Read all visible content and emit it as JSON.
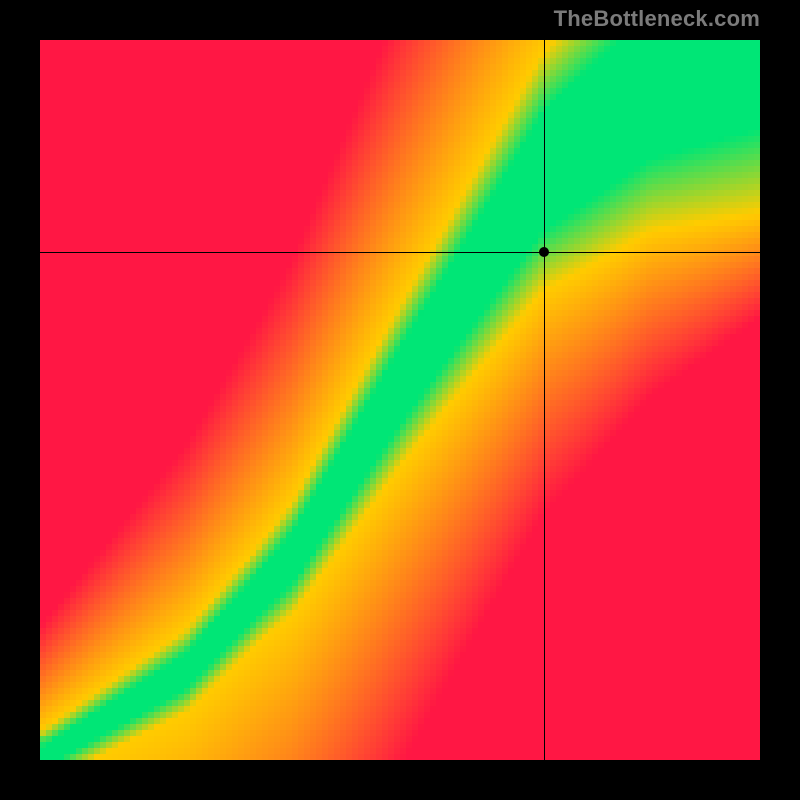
{
  "watermark": "TheBottleneck.com",
  "chart_data": {
    "type": "heatmap",
    "title": "",
    "xlabel": "",
    "ylabel": "",
    "xlim": [
      0,
      100
    ],
    "ylim": [
      0,
      100
    ],
    "grid_resolution": 120,
    "colors": {
      "worst": "#ff1744",
      "mid": "#ffcc00",
      "best": "#00e676"
    },
    "marker": {
      "x": 70,
      "y": 70.5
    },
    "crosshair": {
      "x": 70,
      "y": 70.5
    },
    "ridge_points": [
      {
        "x": 0,
        "y": 0
      },
      {
        "x": 20,
        "y": 12
      },
      {
        "x": 35,
        "y": 28
      },
      {
        "x": 50,
        "y": 52
      },
      {
        "x": 60,
        "y": 67
      },
      {
        "x": 70,
        "y": 82
      },
      {
        "x": 85,
        "y": 94
      },
      {
        "x": 100,
        "y": 100
      }
    ],
    "ridge_width": [
      {
        "x": 0,
        "w": 1.5
      },
      {
        "x": 30,
        "w": 3
      },
      {
        "x": 55,
        "w": 6
      },
      {
        "x": 75,
        "w": 9
      },
      {
        "x": 100,
        "w": 12
      }
    ]
  }
}
